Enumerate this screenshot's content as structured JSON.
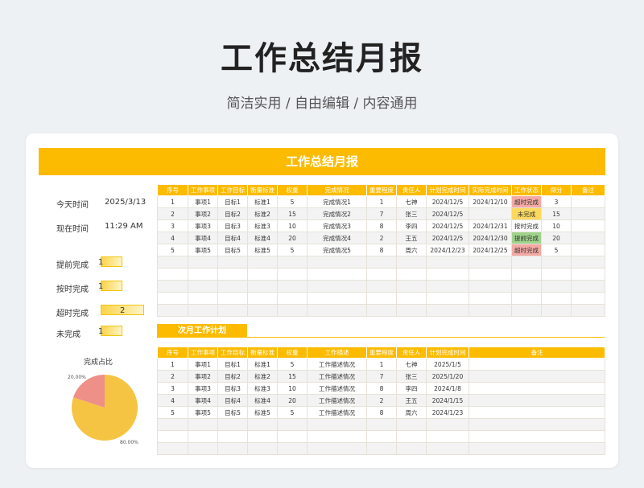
{
  "page": {
    "title": "工作总结月报",
    "subtitle": "简洁实用 / 自由编辑 / 内容通用"
  },
  "report": {
    "banner": "工作总结月报",
    "today_label": "今天时间",
    "today_value": "2025/3/13",
    "now_label": "现在时间",
    "now_value": "11:29 AM",
    "stats": [
      {
        "label": "提前完成",
        "value": "1",
        "fraction": 0.5
      },
      {
        "label": "按时完成",
        "value": "1",
        "fraction": 0.5
      },
      {
        "label": "超时完成",
        "value": "2",
        "fraction": 1.0
      },
      {
        "label": "未完成",
        "value": "1",
        "fraction": 0.5
      }
    ],
    "pie_title": "完成占比",
    "pie": {
      "slices": [
        {
          "label": "20.00%",
          "value": 20,
          "color": "#ee9087"
        },
        {
          "label": "80.00%",
          "value": 80,
          "color": "#f5c443"
        }
      ]
    }
  },
  "table1": {
    "headers": [
      "序号",
      "工作事项",
      "工作目标",
      "衡量标准",
      "权重",
      "完成情况",
      "重要程度",
      "责任人",
      "计划完成时间",
      "实际完成时间",
      "工作状态",
      "得分",
      "备注"
    ],
    "rows": [
      [
        "1",
        "事项1",
        "目标1",
        "标准1",
        "5",
        "完成情况1",
        "1",
        "七神",
        "2024/12/5",
        "2024/12/10",
        "超时完成",
        "3",
        ""
      ],
      [
        "2",
        "事项2",
        "目标2",
        "标准2",
        "15",
        "完成情况2",
        "7",
        "张三",
        "2024/12/5",
        "",
        "未完成",
        "15",
        ""
      ],
      [
        "3",
        "事项3",
        "目标3",
        "标准3",
        "10",
        "完成情况3",
        "8",
        "李四",
        "2024/12/5",
        "2024/12/31",
        "按时完成",
        "10",
        ""
      ],
      [
        "4",
        "事项4",
        "目标4",
        "标准4",
        "20",
        "完成情况4",
        "2",
        "王五",
        "2024/12/5",
        "2024/12/30",
        "提前完成",
        "20",
        ""
      ],
      [
        "5",
        "事项5",
        "目标5",
        "标准5",
        "5",
        "完成情况5",
        "8",
        "周六",
        "2024/12/23",
        "2024/12/25",
        "超时完成",
        "5",
        ""
      ]
    ],
    "status_colors": {
      "超时完成": "red",
      "未完成": "yellow",
      "提前完成": "green",
      "按时完成": ""
    }
  },
  "plan": {
    "title": "次月工作计划",
    "headers": [
      "序号",
      "工作事项",
      "工作目标",
      "衡量标准",
      "权重",
      "工作描述",
      "重要程度",
      "责任人",
      "计划完成时间",
      "备注"
    ],
    "rows": [
      [
        "1",
        "事项1",
        "目标1",
        "标准1",
        "5",
        "工作描述情况",
        "1",
        "七神",
        "2025/1/5",
        ""
      ],
      [
        "2",
        "事项2",
        "目标2",
        "标准2",
        "15",
        "工作描述情况",
        "7",
        "张三",
        "2025/1/20",
        ""
      ],
      [
        "3",
        "事项3",
        "目标3",
        "标准3",
        "10",
        "工作描述情况",
        "8",
        "李四",
        "2024/1/8",
        ""
      ],
      [
        "4",
        "事项4",
        "目标4",
        "标准4",
        "20",
        "工作描述情况",
        "2",
        "王五",
        "2024/1/15",
        ""
      ],
      [
        "5",
        "事项5",
        "目标5",
        "标准5",
        "5",
        "工作描述情况",
        "8",
        "周六",
        "2024/1/23",
        ""
      ]
    ]
  }
}
